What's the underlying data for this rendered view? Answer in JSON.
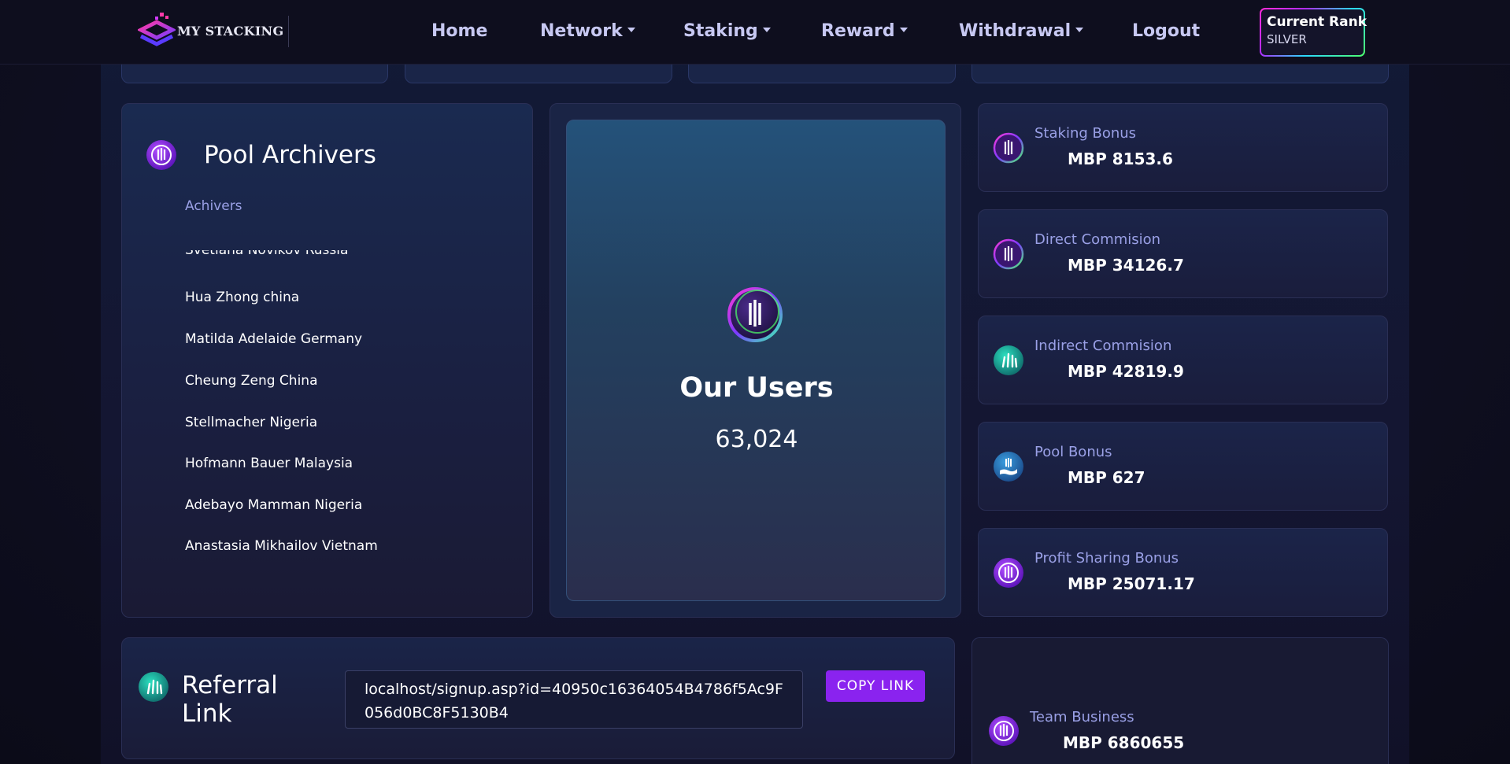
{
  "nav": {
    "brand": "MY STACKING",
    "items": [
      {
        "label": "Home",
        "dropdown": false
      },
      {
        "label": "Network",
        "dropdown": true
      },
      {
        "label": "Staking",
        "dropdown": true
      },
      {
        "label": "Reward",
        "dropdown": true
      },
      {
        "label": "Withdrawal",
        "dropdown": true
      },
      {
        "label": "Logout",
        "dropdown": false
      }
    ],
    "rank": {
      "title": "Current Rank",
      "value": "SILVER"
    }
  },
  "achievers": {
    "title": "Pool Archivers",
    "subtitle": "Achivers",
    "partial_item": "Svetlana Novikov Russia",
    "items": [
      "Hua Zhong china",
      "Matilda Adelaide Germany",
      "Cheung Zeng China",
      "Stellmacher Nigeria",
      "Hofmann Bauer Malaysia",
      "Adebayo Mamman Nigeria",
      "Anastasia Mikhailov Vietnam"
    ]
  },
  "users": {
    "title": "Our Users",
    "count": "63,024"
  },
  "stats": [
    {
      "label": "Staking Bonus",
      "value": "MBP 8153.6",
      "icon": "trident-icon"
    },
    {
      "label": "Direct Commision",
      "value": "MBP 34126.7",
      "icon": "trident-icon"
    },
    {
      "label": "Indirect Commision",
      "value": "MBP 42819.9",
      "icon": "lines-icon"
    },
    {
      "label": "Pool Bonus",
      "value": "MBP 627",
      "icon": "hand-coin-icon"
    },
    {
      "label": "Profit Sharing Bonus",
      "value": "MBP 25071.17",
      "icon": "trident-icon"
    }
  ],
  "referral": {
    "title": "Referral Link",
    "link": "localhost/signup.asp?id=40950c16364054B4786f5Ac9F056d0BC8F5130B4",
    "button": "COPY LINK"
  },
  "team": {
    "label": "Team Business",
    "value": "MBP 6860655"
  },
  "colors": {
    "accent": "#8a23ef",
    "label": "#9aa0e6",
    "nav_text": "#c7c8f2",
    "background": "#0d0d1c"
  }
}
